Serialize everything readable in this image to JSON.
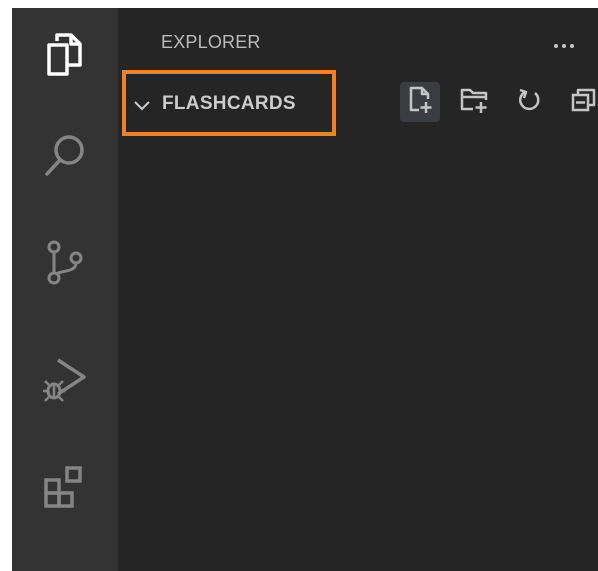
{
  "activity_bar": {
    "items": [
      {
        "name": "explorer",
        "icon": "files-icon",
        "active": true
      },
      {
        "name": "search",
        "icon": "search-icon",
        "active": false
      },
      {
        "name": "source-control",
        "icon": "source-control-icon",
        "active": false
      },
      {
        "name": "run-and-debug",
        "icon": "run-debug-icon",
        "active": false
      },
      {
        "name": "extensions",
        "icon": "extensions-icon",
        "active": false
      }
    ]
  },
  "sidebar": {
    "title": "EXPLORER",
    "more_actions_icon": "ellipsis-icon",
    "section": {
      "name": "FLASHCARDS",
      "expanded": true,
      "highlight_color": "#f0802a",
      "actions": [
        {
          "icon": "new-file-icon"
        },
        {
          "icon": "new-folder-icon"
        },
        {
          "icon": "refresh-icon"
        },
        {
          "icon": "collapse-all-icon"
        }
      ]
    }
  },
  "colors": {
    "activity_bar_bg": "#333333",
    "sidebar_bg": "#252526",
    "active_icon": "#ffffff",
    "inactive_icon": "#858585",
    "highlight": "#f0802a"
  }
}
